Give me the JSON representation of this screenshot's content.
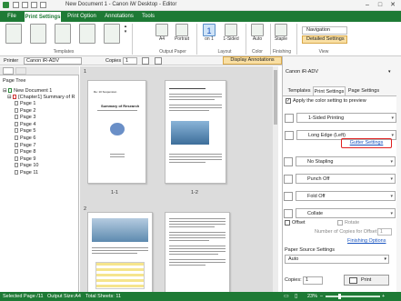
{
  "window": {
    "title": "New Document 1 - Canon iW Desktop - Editor",
    "min": "–",
    "max": "□",
    "close": "✕"
  },
  "tabs": [
    "File",
    "Print Settings",
    "Print Option",
    "Annotations",
    "Tools"
  ],
  "ribbon": {
    "templates_group": "Templates",
    "output_paper": {
      "size": "A4",
      "orientation": "Portrait",
      "group": "Output Paper"
    },
    "layout": {
      "pages": "1",
      "pages_sub": "on 1",
      "sided": "1-Sided",
      "group": "Layout"
    },
    "color": {
      "mode": "Auto",
      "group": "Color"
    },
    "finishing": {
      "staple": "Staple",
      "group": "Finishing"
    },
    "view": {
      "navigation": "Navigation",
      "detailed": "Detailed Settings",
      "group": "View"
    }
  },
  "printer_row": {
    "label": "Printer",
    "printer": "Canon iR-ADV",
    "copies_label": "Copies",
    "copies": "1",
    "annotations_button": "Display Annotations"
  },
  "tree": {
    "header": "Page Tree",
    "doc": "New Document 1",
    "chapter": "[Chapter1] Summary of R",
    "pages": [
      "Page 1",
      "Page 2",
      "Page 3",
      "Page 4",
      "Page 5",
      "Page 6",
      "Page 7",
      "Page 8",
      "Page 9",
      "Page 10",
      "Page 11"
    ]
  },
  "thumbnails": {
    "p1_label": "1-1",
    "p2_label": "1-2",
    "p1_title": "Summary of Research",
    "p1_heading": "Re: 10 Suspension",
    "section1": "1",
    "section2": "2"
  },
  "right": {
    "printer": "Canon iR-ADV",
    "tabs": [
      "Templates",
      "Print Settings",
      "Page Settings"
    ],
    "apply_color": "Apply the color setting to preview",
    "sided": "1-Sided Printing",
    "edge": "Long Edge (Left)",
    "gutter": "Gutter Settings",
    "stapling": "No Stapling",
    "punch": "Punch Off",
    "fold": "Fold Off",
    "collate": "Collate",
    "offset": "Offset",
    "rotate": "Rotate",
    "copies_offset": "Number of Copies for Offset",
    "copies_offset_value": "1",
    "finishing": "Finishing Options",
    "paper_source_label": "Paper Source Settings",
    "paper_source": "Auto",
    "copies_label": "Copies:",
    "copies": "1",
    "print": "Print"
  },
  "status": {
    "selected": "Selected Page /11",
    "output": "Output Size:A4",
    "total": "Total Sheets: 11",
    "zoom": "23%"
  }
}
